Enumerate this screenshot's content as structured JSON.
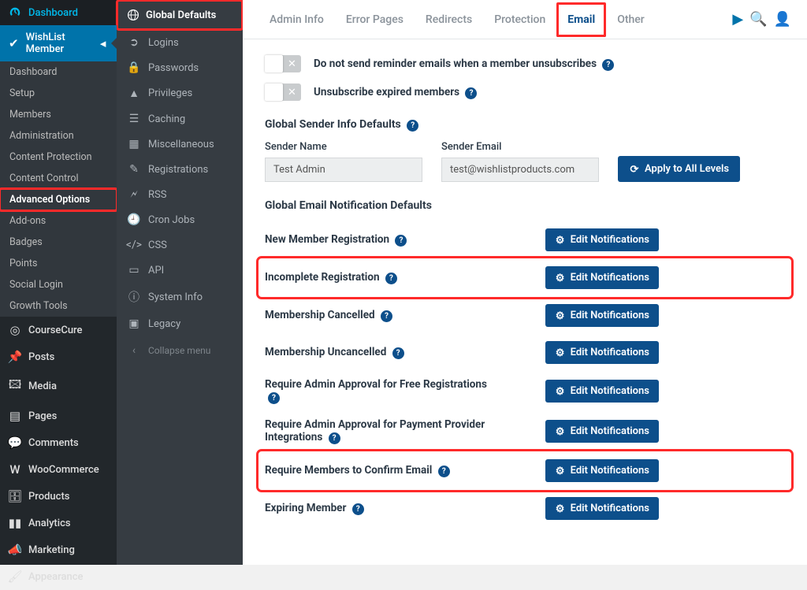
{
  "sidebar": {
    "dashboard": "Dashboard",
    "wishlist": "WishList Member",
    "sub": {
      "dashboard": "Dashboard",
      "setup": "Setup",
      "members": "Members",
      "administration": "Administration",
      "content_protection": "Content Protection",
      "content_control": "Content Control",
      "advanced_options": "Advanced Options",
      "addons": "Add-ons",
      "badges": "Badges",
      "points": "Points",
      "social_login": "Social Login",
      "growth_tools": "Growth Tools"
    },
    "coursecure": "CourseCure",
    "posts": "Posts",
    "media": "Media",
    "pages": "Pages",
    "comments": "Comments",
    "woocommerce": "WooCommerce",
    "products": "Products",
    "analytics": "Analytics",
    "marketing": "Marketing",
    "appearance": "Appearance"
  },
  "sidebar2": {
    "head": "Global Defaults",
    "items": {
      "logins": "Logins",
      "passwords": "Passwords",
      "privileges": "Privileges",
      "caching": "Caching",
      "miscellaneous": "Miscellaneous",
      "registrations": "Registrations",
      "rss": "RSS",
      "cron": "Cron Jobs",
      "css": "CSS",
      "api": "API",
      "system": "System Info",
      "legacy": "Legacy"
    },
    "collapse": "Collapse menu"
  },
  "tabs": {
    "admin_info": "Admin Info",
    "error_pages": "Error Pages",
    "redirects": "Redirects",
    "protection": "Protection",
    "email": "Email",
    "other": "Other"
  },
  "content": {
    "toggles": {
      "no_reminder": "Do not send reminder emails when a member unsubscribes",
      "unsub_expired": "Unsubscribe expired members"
    },
    "sender": {
      "title": "Global Sender Info Defaults",
      "name_label": "Sender Name",
      "name_value": "Test Admin",
      "email_label": "Sender Email",
      "email_value": "test@wishlistproducts.com",
      "apply_btn": "Apply to All Levels"
    },
    "notifications": {
      "title": "Global Email Notification Defaults",
      "btn": "Edit Notifications",
      "items": {
        "new_member": "New Member Registration",
        "incomplete": "Incomplete Registration",
        "cancelled": "Membership Cancelled",
        "uncancelled": "Membership Uncancelled",
        "admin_free": "Require Admin Approval for Free Registrations",
        "admin_pay": "Require Admin Approval for Payment Provider Integrations",
        "confirm_email": "Require Members to Confirm Email",
        "expiring": "Expiring Member"
      }
    }
  }
}
